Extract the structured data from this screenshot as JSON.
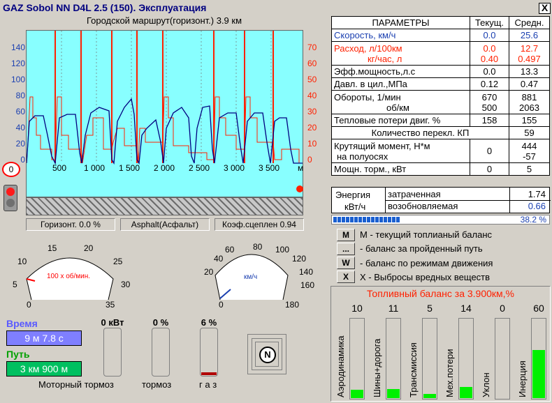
{
  "window": {
    "title": "GAZ Sobol NN  D4L 2.5 (150).  Эксплуатация",
    "close_label": "X"
  },
  "chart_data": {
    "type": "line",
    "title": "Городской маршрут(горизонт.) 3.9 км",
    "x_ticks": [
      "500",
      "1 000",
      "1 500",
      "2 000",
      "2 500",
      "3 000",
      "3 500",
      "м"
    ],
    "y_left_ticks": [
      "140",
      "120",
      "100",
      "80",
      "60",
      "40",
      "20",
      "0"
    ],
    "y_right_ticks": [
      "70",
      "60",
      "50",
      "40",
      "30",
      "20",
      "10",
      "0"
    ],
    "series": []
  },
  "left_marker": "0",
  "status": {
    "grade": "Горизонт. 0.0 %",
    "surface": "Asphalt(Асфальт)",
    "adhesion": "Коэф.сцеплен 0.94"
  },
  "tacho": {
    "ticks": [
      "0",
      "5",
      "10",
      "15",
      "20",
      "25",
      "30",
      "35"
    ],
    "unit": "100 х об/мин."
  },
  "speedo": {
    "ticks": [
      "0",
      "20",
      "40",
      "60",
      "80",
      "100",
      "120",
      "140",
      "160",
      "180"
    ],
    "unit": "км/ч"
  },
  "time": {
    "label": "Время",
    "value": "9 м 7.8 с"
  },
  "path": {
    "label": "Путь",
    "value": "3 км 900 м"
  },
  "engine_brake": {
    "value": "0 кВт",
    "label": "Моторный тормоз",
    "level": 0
  },
  "brake": {
    "value": "0 %",
    "label": "тормоз",
    "level": 0
  },
  "gas": {
    "value": "6 %",
    "label": "г а з",
    "level": 0.06
  },
  "gear": "N",
  "params": {
    "head": [
      "ПАРАМЕТРЫ",
      "Текущ.",
      "Средн."
    ],
    "speed": {
      "label": "Скорость,  км/ч",
      "cur": "0.0",
      "avg": "25.6"
    },
    "fuel": {
      "label1": "Расход, л/100км",
      "label2": "кг/час,  л",
      "cur1": "0.0",
      "avg1": "12.7",
      "cur2": "0.40",
      "avg2": "0.497"
    },
    "power": {
      "label": "Эфф.мощность,л.с",
      "cur": "0.0",
      "avg": "13.3"
    },
    "pressure": {
      "label": "Давл. в цил.,МПа",
      "cur": "0.12",
      "avg": "0.47"
    },
    "rpm": {
      "label1": "Обороты, 1/мин",
      "label2": "об/км",
      "cur1": "670",
      "avg1": "881",
      "cur2": "500",
      "avg2": "2063"
    },
    "heat": {
      "label": "Тепловые потери двиг. %",
      "cur": "158",
      "avg": "155"
    },
    "shifts": {
      "label": "Количество перекл. КП",
      "avg": "59"
    },
    "torque": {
      "label1": "Крутящий момент, Н*м",
      "label2": "на полуосях",
      "cur": "0",
      "avg1": "444",
      "avg2": "-57"
    },
    "brake_power": {
      "label": "Мощн. торм., кВт",
      "cur": "0",
      "avg": "5"
    },
    "energy": {
      "label1": "Энергия",
      "label2": "кВт/ч",
      "spent_label": "затраченная",
      "spent": "1.74",
      "recov_label": "возобновляемая",
      "recov": "0.66"
    }
  },
  "progress": {
    "value": 0.382,
    "label": "38.2 %"
  },
  "legend": [
    {
      "key": "M",
      "text": "M - текущий топлианый баланс"
    },
    {
      "key": "...",
      "text": "- баланс за пройденный путь"
    },
    {
      "key": "W",
      "text": "- баланс по режимам движения"
    },
    {
      "key": "X",
      "text": "X - Выбросы вредных веществ"
    }
  ],
  "fuel_balance": {
    "title": "Топливный баланс за 3.900км,%",
    "items": [
      {
        "label": "Аэродинамика",
        "value": "10",
        "level": 0.1
      },
      {
        "label": "Шины+дорога",
        "value": "11",
        "level": 0.11
      },
      {
        "label": "Трансмиссия",
        "value": "5",
        "level": 0.05
      },
      {
        "label": "Мех.потери",
        "value": "14",
        "level": 0.14
      },
      {
        "label": "Уклон",
        "value": "0",
        "level": 0
      },
      {
        "label": "Инерция",
        "value": "60",
        "level": 0.6
      }
    ]
  }
}
